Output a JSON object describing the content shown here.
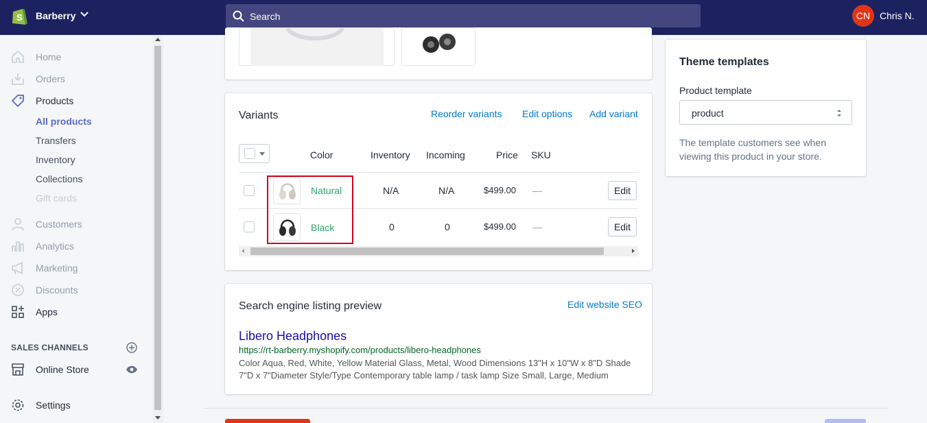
{
  "topbar": {
    "store_name": "Barberry",
    "search_placeholder": "Search",
    "user_initials": "CN",
    "user_name": "Chris N.",
    "colors": {
      "bar": "#1c2260",
      "avatar": "#de3618"
    }
  },
  "sidebar": {
    "items": [
      {
        "label": "Home",
        "icon": "home-icon"
      },
      {
        "label": "Orders",
        "icon": "orders-icon"
      },
      {
        "label": "Products",
        "icon": "tag-icon"
      },
      {
        "label": "Customers",
        "icon": "customer-icon"
      },
      {
        "label": "Analytics",
        "icon": "analytics-icon"
      },
      {
        "label": "Marketing",
        "icon": "megaphone-icon"
      },
      {
        "label": "Discounts",
        "icon": "discount-icon"
      },
      {
        "label": "Apps",
        "icon": "apps-icon"
      }
    ],
    "products_sub": [
      "All products",
      "Transfers",
      "Inventory",
      "Collections",
      "Gift cards"
    ],
    "sales_channels_title": "SALES CHANNELS",
    "online_store": "Online Store",
    "settings": "Settings"
  },
  "variants": {
    "title": "Variants",
    "reorder": "Reorder variants",
    "edit_options": "Edit options",
    "add_variant": "Add variant",
    "columns": [
      "Color",
      "Inventory",
      "Incoming",
      "Price",
      "SKU"
    ],
    "rows": [
      {
        "color": "Natural",
        "inventory": "N/A",
        "incoming": "N/A",
        "price": "$499.00",
        "sku": "—",
        "edit": "Edit"
      },
      {
        "color": "Black",
        "inventory": "0",
        "incoming": "0",
        "price": "$499.00",
        "sku": "—",
        "edit": "Edit"
      }
    ]
  },
  "seo": {
    "title": "Search engine listing preview",
    "edit_link": "Edit website SEO",
    "page_title": "Libero Headphones",
    "url": "https://rt-barberry.myshopify.com/products/libero-headphones",
    "description": "Color Aqua, Red, White, Yellow Material Glass, Metal, Wood Dimensions 13\"H x 10\"W x 8\"D Shade 7\"D x 7\"Diameter Style/Type Contemporary table lamp / task lamp Size Small, Large, Medium"
  },
  "theme": {
    "title": "Theme templates",
    "template_label": "Product template",
    "template_value": "product",
    "help_text": "The template customers see when viewing this product in your store."
  }
}
